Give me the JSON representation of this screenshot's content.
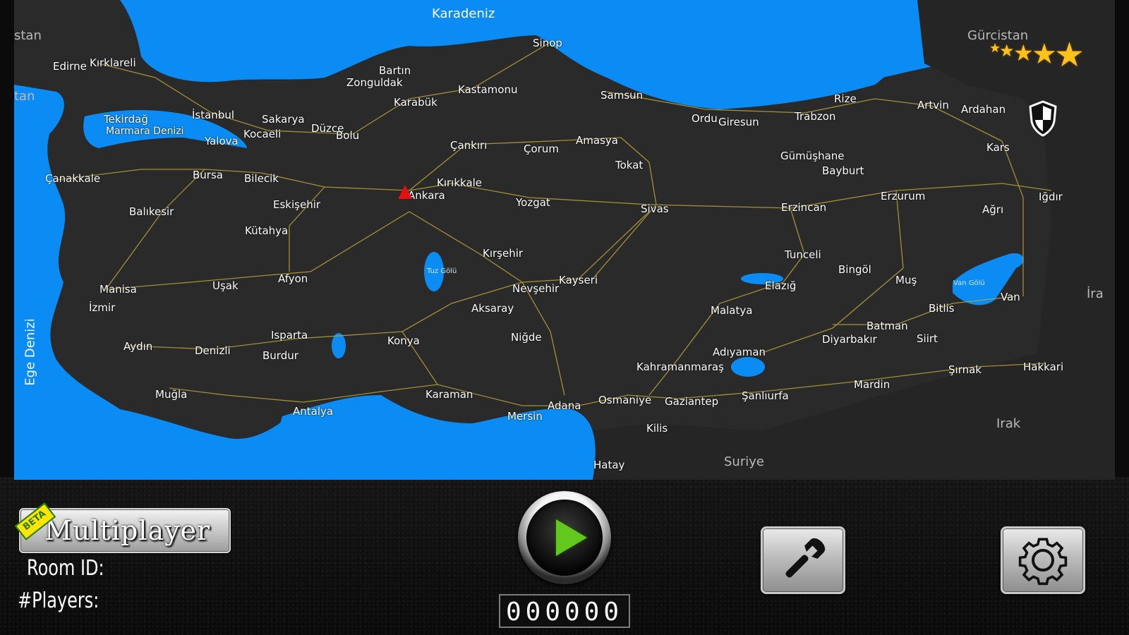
{
  "map": {
    "seas": {
      "black_sea": "Karadeniz",
      "marmara": "Marmara Denizi",
      "aegean": "Ege Denizi"
    },
    "neighbors": [
      "stan",
      "tan",
      "Gürcistan",
      "İra",
      "Irak",
      "Suriye"
    ],
    "lakes": [
      "Tuz Gölü",
      "Van Gölü"
    ],
    "cities": [
      "Edirne",
      "Kırklareli",
      "Tekirdağ",
      "İstanbul",
      "Sakarya",
      "Düzce",
      "Zonguldak",
      "Bartın",
      "Karabük",
      "Kastamonu",
      "Sinop",
      "Samsun",
      "Ordu",
      "Giresun",
      "Trabzon",
      "Rize",
      "Artvin",
      "Ardahan",
      "Kars",
      "Iğdır",
      "Ağrı",
      "Erzurum",
      "Bayburt",
      "Gümüşhane",
      "Erzincan",
      "Tunceli",
      "Bingöl",
      "Muş",
      "Van",
      "Bitlis",
      "Hakkari",
      "Şırnak",
      "Siirt",
      "Batman",
      "Mardin",
      "Diyarbakır",
      "Elazığ",
      "Malatya",
      "Adıyaman",
      "Şanlıurfa",
      "Gaziantep",
      "Kilis",
      "Hatay",
      "Osmaniye",
      "Adana",
      "Mersin",
      "Kahramanmaraş",
      "Karaman",
      "Niğde",
      "Aksaray",
      "Nevşehir",
      "Kayseri",
      "Sivas",
      "Tokat",
      "Amasya",
      "Çorum",
      "Çankırı",
      "Kırıkkale",
      "Ankara",
      "Yozgat",
      "Kırşehir",
      "Konya",
      "Antalya",
      "Isparta",
      "Burdur",
      "Denizli",
      "Muğla",
      "Aydın",
      "İzmir",
      "Manisa",
      "Uşak",
      "Afyon",
      "Kütahya",
      "Eskişehir",
      "Bilecik",
      "Bursa",
      "Yalova",
      "Kocaeli",
      "Bolu",
      "Balıkesir",
      "Çanakkale"
    ],
    "land_color": "#2a2a2a",
    "water_color": "#0a8cf4",
    "road_color": "#b8a23a",
    "marker_icon": "player-location-marker"
  },
  "stars": {
    "count": 5,
    "icon": "star-icon",
    "color": "#ffc21a"
  },
  "shield_icon": "shield-icon",
  "multiplayer": {
    "label": "Multiplayer",
    "badge": "BETA"
  },
  "room": {
    "label": "Room ID:",
    "value": ""
  },
  "players": {
    "label": "#Players:",
    "value": ""
  },
  "counter": {
    "value": "000000"
  },
  "buttons": {
    "play": "play-icon",
    "tools": "wrench-icon",
    "settings": "gear-icon"
  }
}
